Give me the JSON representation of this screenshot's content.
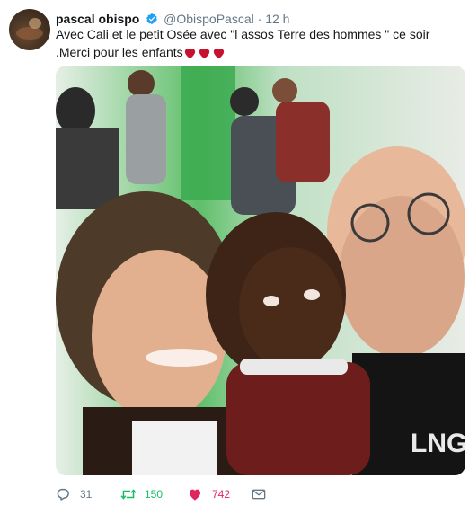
{
  "tweet": {
    "display_name": "pascal obispo",
    "handle": "@ObispoPascal",
    "separator": "·",
    "time": "12 h",
    "text": "Avec Cali et le petit Osée avec \"l assos Terre des hommes \" ce soir .Merci pour les enfants",
    "emoji": [
      "heart",
      "heart",
      "heart"
    ],
    "stats": {
      "replies": "31",
      "retweets": "150",
      "likes": "742"
    }
  },
  "colors": {
    "text": "#14171a",
    "muted": "#657786",
    "verified": "#1da1f2",
    "retweet": "#17bf63",
    "like": "#e0245e",
    "emoji_heart": "#c4122f"
  },
  "icons": {
    "verified": "verified-badge-icon",
    "reply": "reply-icon",
    "retweet": "retweet-icon",
    "like": "heart-icon",
    "message": "envelope-icon"
  }
}
